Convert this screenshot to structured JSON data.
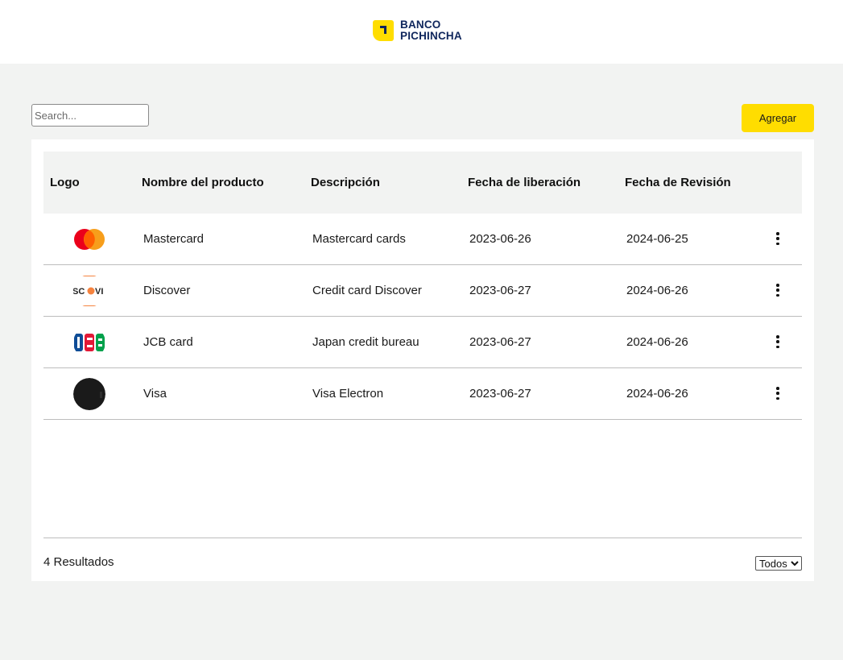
{
  "brand": {
    "line1": "BANCO",
    "line2": "PICHINCHA",
    "colors": {
      "yellow": "#ffdd00",
      "navy": "#0f265c"
    }
  },
  "toolbar": {
    "search_placeholder": "Search...",
    "add_label": "Agregar"
  },
  "table": {
    "headers": {
      "logo": "Logo",
      "name": "Nombre del producto",
      "description": "Descripción",
      "release": "Fecha de liberación",
      "revision": "Fecha de Revisión"
    },
    "rows": [
      {
        "logo_icon": "mastercard-logo-icon",
        "name": "Mastercard",
        "description": "Mastercard cards",
        "release": "2023-06-26",
        "revision": "2024-06-25"
      },
      {
        "logo_icon": "discover-logo-icon",
        "name": "Discover",
        "description": "Credit card Discover",
        "release": "2023-06-27",
        "revision": "2024-06-26"
      },
      {
        "logo_icon": "jcb-logo-icon",
        "name": "JCB card",
        "description": "Japan credit bureau",
        "release": "2023-06-27",
        "revision": "2024-06-26"
      },
      {
        "logo_icon": "visa-logo-icon",
        "name": "Visa",
        "description": "Visa Electron",
        "release": "2023-06-27",
        "revision": "2024-06-26"
      }
    ]
  },
  "footer": {
    "results": "4 Resultados",
    "page_size_selected": "Todos"
  },
  "colors": {
    "background": "#f2f3f2",
    "accent_button": "#ffdd00",
    "divider": "#bdbdbd"
  }
}
